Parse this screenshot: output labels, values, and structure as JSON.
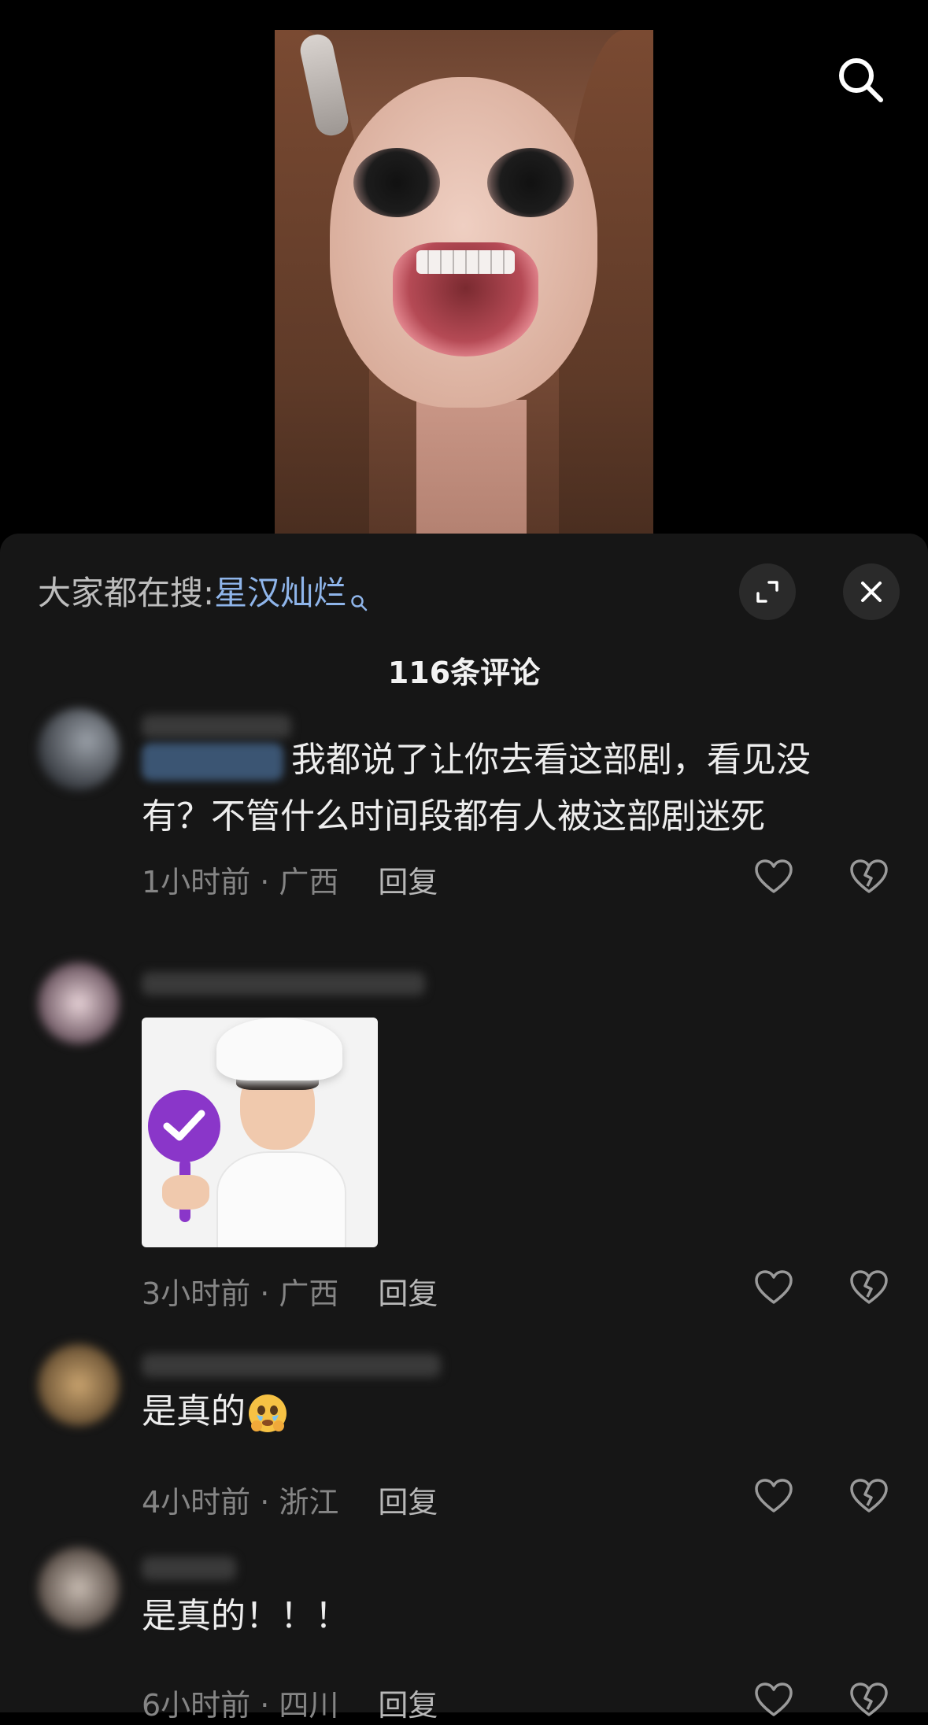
{
  "search_suggest": {
    "prefix": "大家都在搜:",
    "term": "星汉灿烂"
  },
  "comment_count_title": "116条评论",
  "comments": [
    {
      "text": "我都说了让你去看这部剧，看见没有？不管什么时间段都有人被这部剧迷死",
      "time_location": "1小时前 · 广西",
      "reply_label": "回复",
      "has_mention": true
    },
    {
      "text": "",
      "time_location": "3小时前 · 广西",
      "reply_label": "回复",
      "has_sticker": true
    },
    {
      "text": "是真的",
      "time_location": "4小时前 · 浙江",
      "reply_label": "回复",
      "emoji": "crying-face-holding-back-tears"
    },
    {
      "text": "是真的！！！",
      "time_location": "6小时前 · 四川",
      "reply_label": "回复"
    }
  ],
  "colors": {
    "sheet_bg": "#161616",
    "search_term": "#8fb5ea",
    "meta_text": "#858585",
    "icon_btn_bg": "#2a2a2a"
  },
  "icons": [
    "search-icon",
    "expand-icon",
    "close-icon",
    "heart-icon",
    "broken-heart-icon"
  ]
}
